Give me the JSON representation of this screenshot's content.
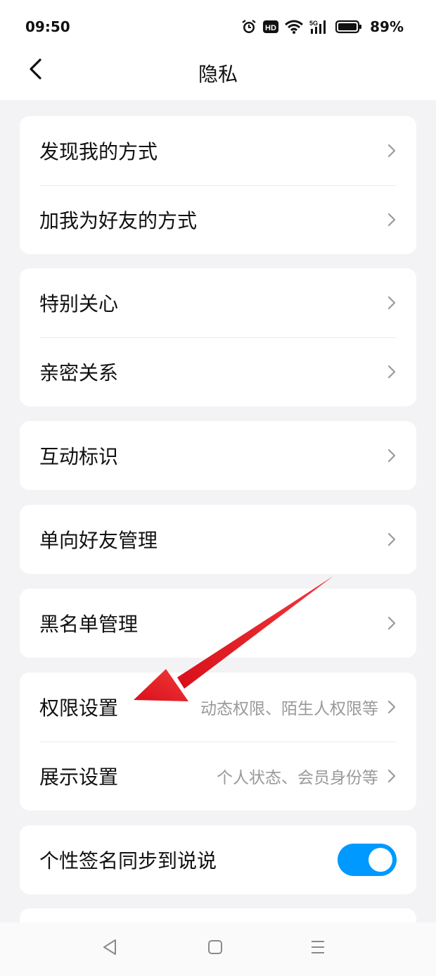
{
  "status_bar": {
    "time": "09:50",
    "battery_percent": "89%",
    "icons": [
      "alarm-icon",
      "hd-icon",
      "wifi-icon",
      "5g-signal-icon",
      "battery-icon"
    ]
  },
  "header": {
    "title": "隐私",
    "back_icon": "chevron-left-icon"
  },
  "groups": [
    {
      "rows": [
        {
          "label": "发现我的方式"
        },
        {
          "label": "加我为好友的方式"
        }
      ]
    },
    {
      "rows": [
        {
          "label": "特别关心"
        },
        {
          "label": "亲密关系"
        }
      ]
    },
    {
      "rows": [
        {
          "label": "互动标识"
        }
      ]
    },
    {
      "rows": [
        {
          "label": "单向好友管理"
        }
      ]
    },
    {
      "rows": [
        {
          "label": "黑名单管理"
        }
      ]
    },
    {
      "rows": [
        {
          "label": "权限设置",
          "sub": "动态权限、陌生人权限等"
        },
        {
          "label": "展示设置",
          "sub": "个人状态、会员身份等"
        }
      ]
    },
    {
      "rows": [
        {
          "label": "个性签名同步到说说",
          "toggle": true
        }
      ]
    }
  ],
  "system_nav": {
    "buttons": [
      "back-triangle-icon",
      "home-square-icon",
      "menu-icon"
    ]
  },
  "colors": {
    "accent": "#0099ff",
    "annotation_arrow": "#e0141e",
    "background": "#f3f3f5"
  }
}
